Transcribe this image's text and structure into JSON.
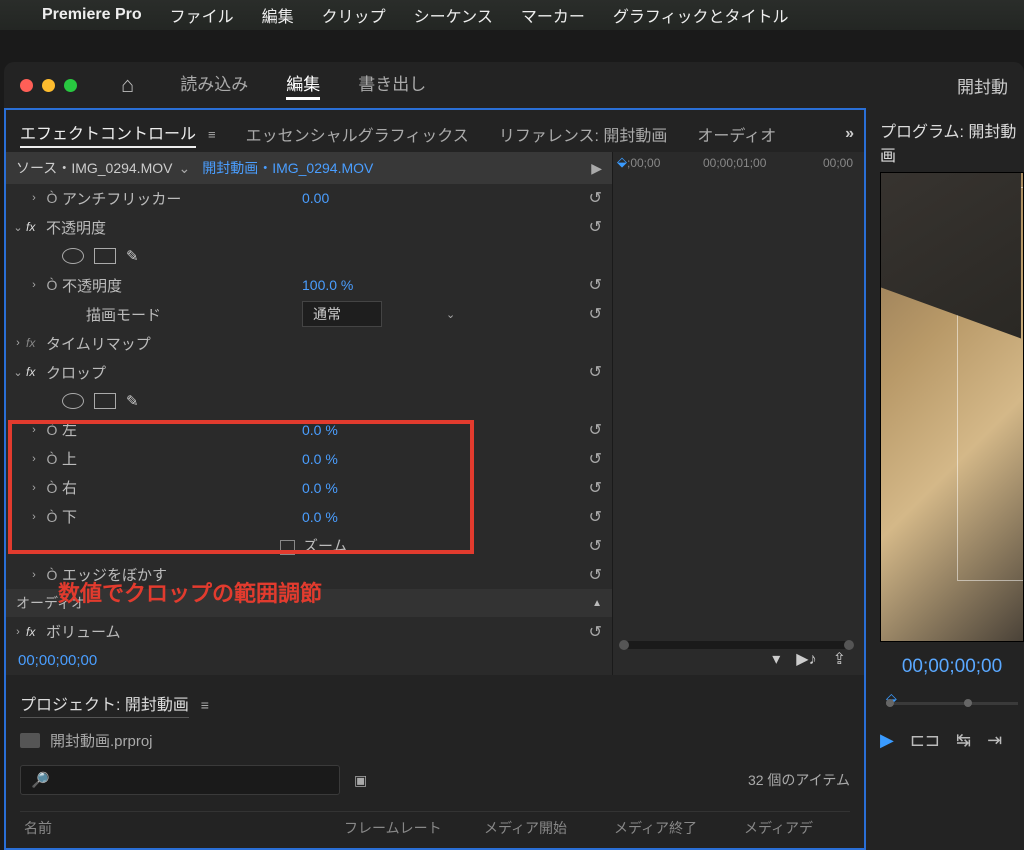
{
  "menubar": {
    "app": "Premiere Pro",
    "items": [
      "ファイル",
      "編集",
      "クリップ",
      "シーケンス",
      "マーカー",
      "グラフィックとタイトル"
    ]
  },
  "topTabs": {
    "import": "読み込み",
    "edit": "編集",
    "export": "書き出し",
    "rightLabel": "開封動"
  },
  "panelTabs": {
    "effectControls": "エフェクトコントロール",
    "essentialGraphics": "エッセンシャルグラフィックス",
    "reference": "リファレンス: 開封動画",
    "audio": "オーディオ"
  },
  "source": {
    "prefix": "ソース・",
    "srcClip": "IMG_0294.MOV",
    "seq": "開封動画・IMG_0294.MOV"
  },
  "timelineRuler": {
    "t0": ";00;00",
    "t1": "00;00;01;00",
    "t2": "00;00"
  },
  "effects": {
    "antiFlicker": {
      "label": "アンチフリッカー",
      "value": "0.00"
    },
    "opacity": {
      "label": "不透明度",
      "value": "100.0 %",
      "blendLabel": "描画モード",
      "blendValue": "通常"
    },
    "timeRemap": {
      "label": "タイムリマップ"
    },
    "crop": {
      "label": "クロップ",
      "left": {
        "label": "左",
        "value": "0.0 %"
      },
      "top": {
        "label": "上",
        "value": "0.0 %"
      },
      "right": {
        "label": "右",
        "value": "0.0 %"
      },
      "bottom": {
        "label": "下",
        "value": "0.0 %"
      },
      "edgeFeather": {
        "label": "エッジをぼかす"
      },
      "zoom": {
        "label": "ズーム"
      }
    },
    "audioSection": "オーディオ",
    "volume": {
      "label": "ボリューム"
    }
  },
  "annotation": "数値でクロップの範囲調節",
  "timecode": "00;00;00;00",
  "project": {
    "title": "プロジェクト: 開封動画",
    "file": "開封動画.prproj",
    "searchPlaceholder": "🔎",
    "itemCount": "32 個のアイテム",
    "cols": [
      "名前",
      "フレームレート",
      "メディア開始",
      "メディア終了",
      "メディアデ"
    ]
  },
  "program": {
    "title": "プログラム: 開封動画",
    "timecode": "00;00;00;00"
  }
}
